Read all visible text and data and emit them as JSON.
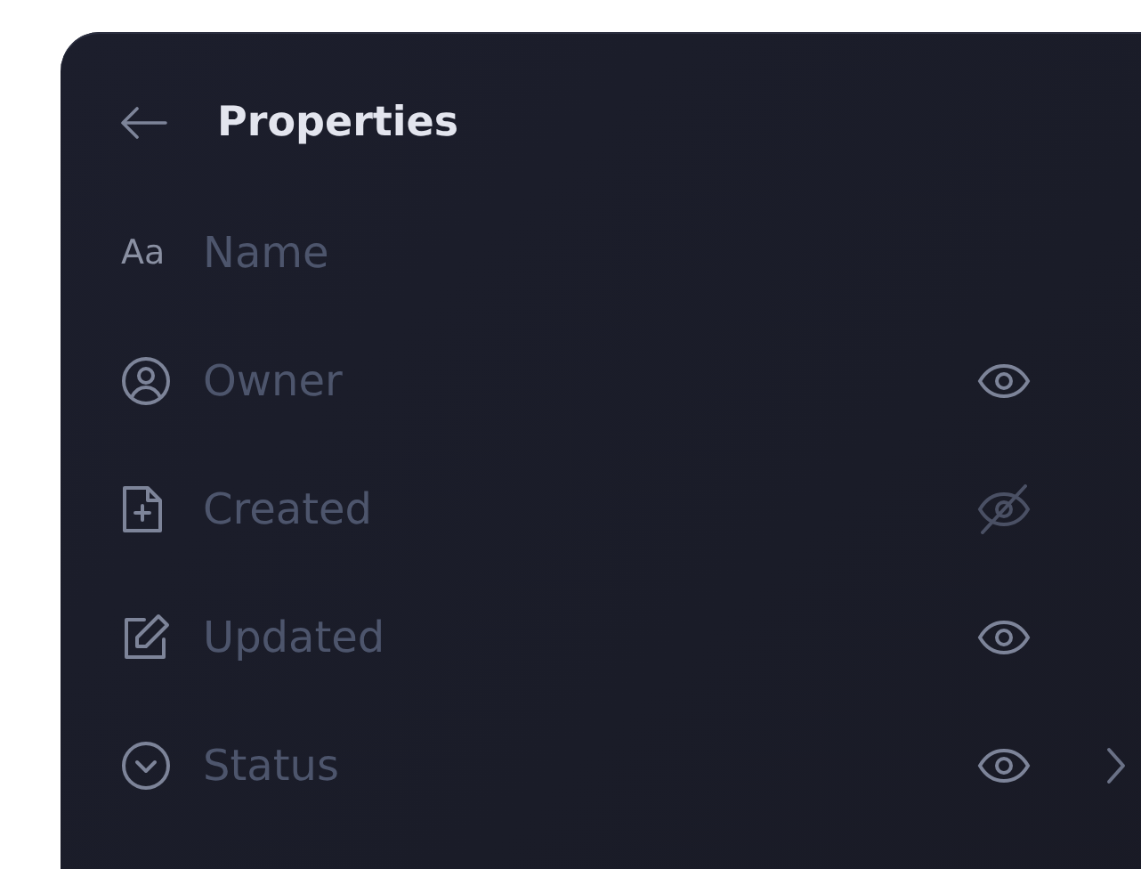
{
  "header": {
    "title": "Properties"
  },
  "properties": [
    {
      "kind": "title",
      "icon_text": "Aa",
      "label": "Name"
    },
    {
      "kind": "property",
      "label": "Owner",
      "visible": true,
      "expandable": false
    },
    {
      "kind": "property",
      "label": "Created",
      "visible": false,
      "expandable": false
    },
    {
      "kind": "property",
      "label": "Updated",
      "visible": true,
      "expandable": false
    },
    {
      "kind": "property",
      "label": "Status",
      "visible": true,
      "expandable": true
    }
  ]
}
